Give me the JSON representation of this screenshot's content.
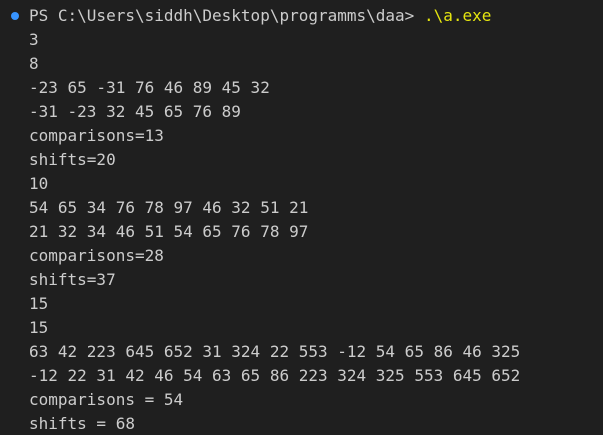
{
  "terminal": {
    "prompt": "PS C:\\Users\\siddh\\Desktop\\programms\\daa> ",
    "command": ".\\a.exe",
    "lines": [
      "3",
      "8",
      "-23 65 -31 76 46 89 45 32",
      "-31 -23 32 45 65 76 89",
      "comparisons=13",
      "shifts=20",
      "10",
      "54 65 34 76 78 97 46 32 51 21",
      "21 32 34 46 51 54 65 76 78 97",
      "comparisons=28",
      "shifts=37",
      "15",
      "15",
      "63 42 223 645 652 31 324 22 553 -12 54 65 86 46 325",
      "-12 22 31 42 46 54 63 65 86 223 324 325 553 645 652",
      "comparisons = 54",
      "shifts = 68"
    ]
  },
  "colors": {
    "background": "#1f1f1f",
    "text": "#cccccc",
    "command": "#e5e510",
    "prompt_dot": "#3794ff"
  },
  "icons": {
    "prompt_indicator": "circle-dot-icon"
  }
}
